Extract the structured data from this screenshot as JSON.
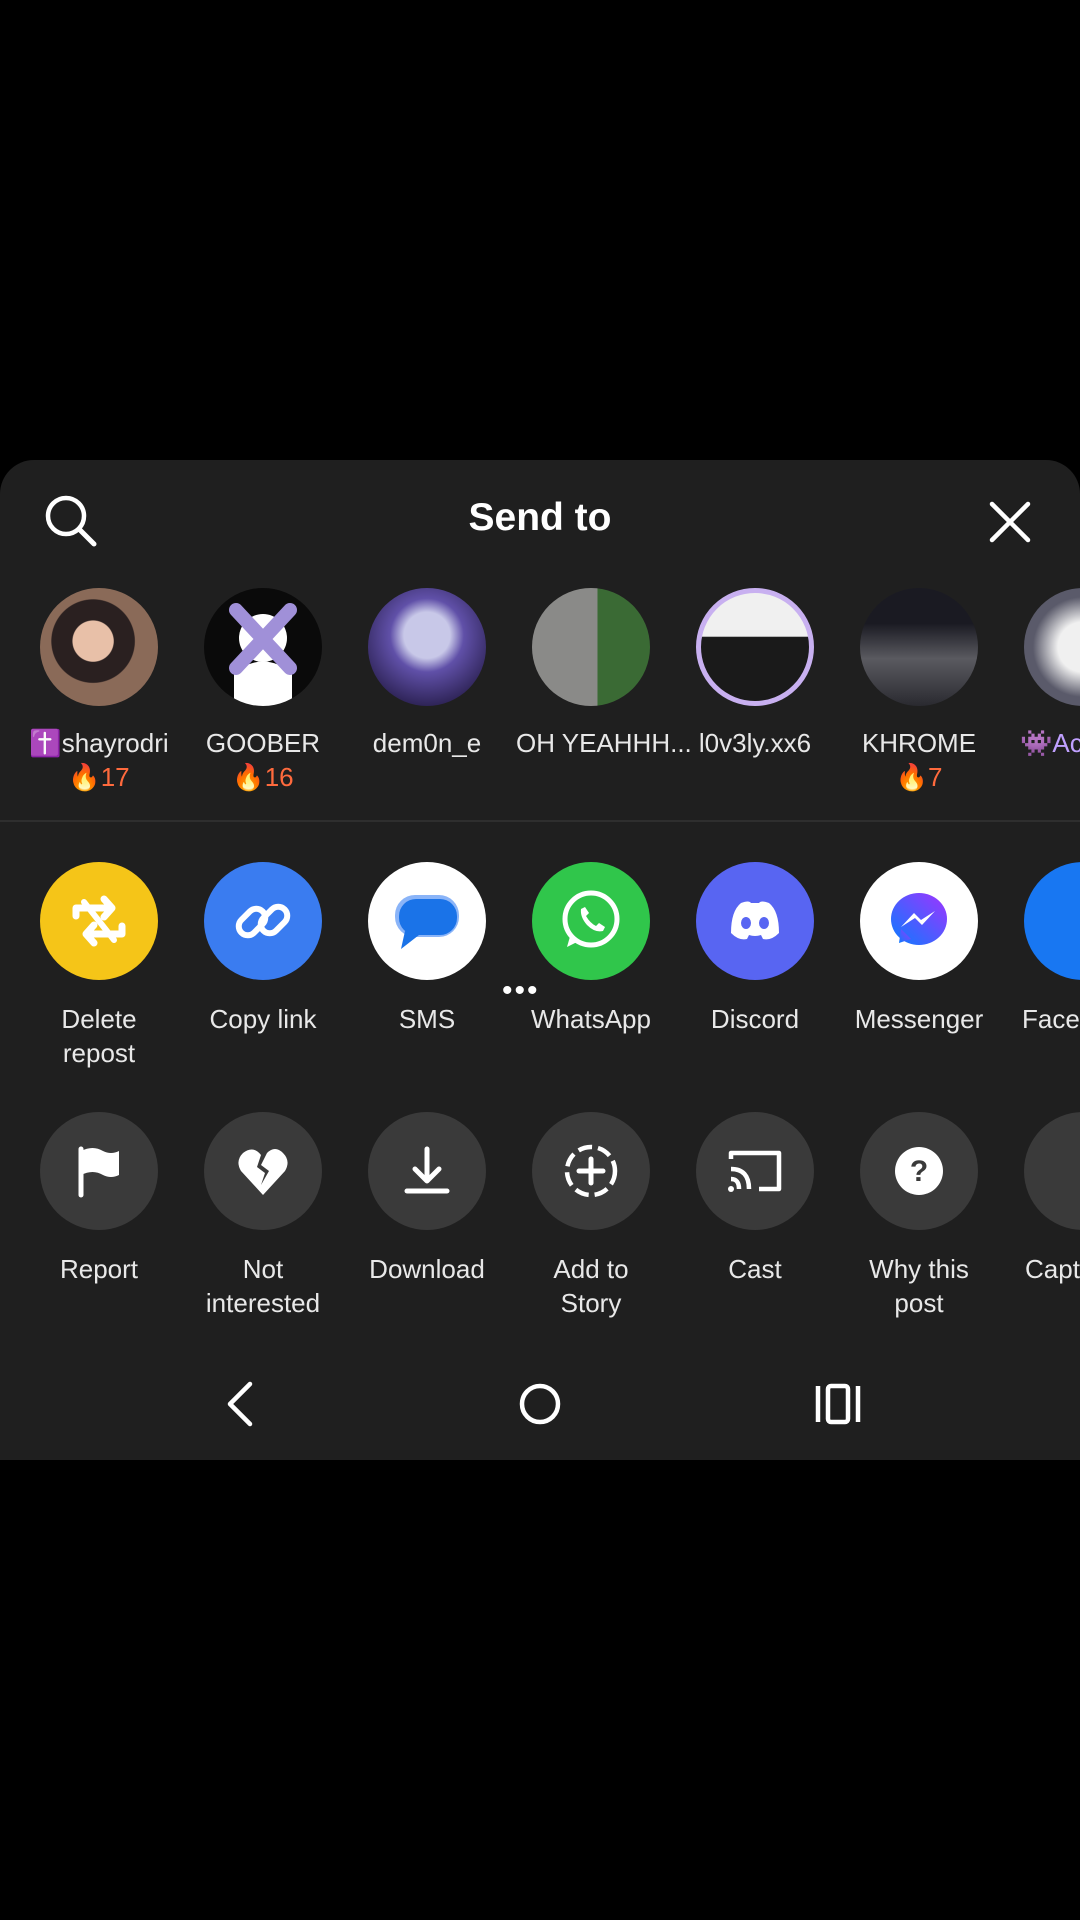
{
  "header": {
    "title": "Send to"
  },
  "contacts": [
    {
      "name": "✝️shayrodri",
      "streak": "🔥17",
      "avatar_color": "#6a5a50"
    },
    {
      "name": "GOOBER",
      "streak": "🔥16",
      "avatar_color": "#0a0a0a"
    },
    {
      "name": "dem0n_e",
      "streak": "",
      "avatar_color": "#4a3a8a"
    },
    {
      "name": "OH YEAHHH...",
      "streak": "",
      "avatar_color": "#6c7066"
    },
    {
      "name": "l0v3ly.xx6",
      "streak": "",
      "avatar_color": "#d8d0e0"
    },
    {
      "name": "KHROME",
      "streak": "🔥7",
      "avatar_color": "#3a3a40"
    },
    {
      "name": "👾Ac",
      "streak": "",
      "avatar_color": "#d8d8d8"
    }
  ],
  "apps": [
    {
      "label": "Delete repost",
      "icon": "repost-icon",
      "color": "#f5c518"
    },
    {
      "label": "Copy link",
      "icon": "link-icon",
      "color": "#3a7cf0"
    },
    {
      "label": "SMS",
      "icon": "sms-icon",
      "color": "#ffffff"
    },
    {
      "label": "WhatsApp",
      "icon": "whatsapp-icon",
      "color": "#30c64b"
    },
    {
      "label": "Discord",
      "icon": "discord-icon",
      "color": "#5865f2"
    },
    {
      "label": "Messenger",
      "icon": "messenger-icon",
      "color": "#ffffff"
    },
    {
      "label": "Face",
      "icon": "facebook-icon",
      "color": "#1877f2"
    }
  ],
  "actions": [
    {
      "label": "Report",
      "icon": "flag-icon"
    },
    {
      "label": "Not interested",
      "icon": "broken-heart-icon"
    },
    {
      "label": "Download",
      "icon": "download-icon"
    },
    {
      "label": "Add to Story",
      "icon": "add-story-icon"
    },
    {
      "label": "Cast",
      "icon": "cast-icon"
    },
    {
      "label": "Why this post",
      "icon": "question-icon"
    },
    {
      "label": "Capt",
      "icon": "caption-icon"
    }
  ],
  "more_dots": "•••"
}
